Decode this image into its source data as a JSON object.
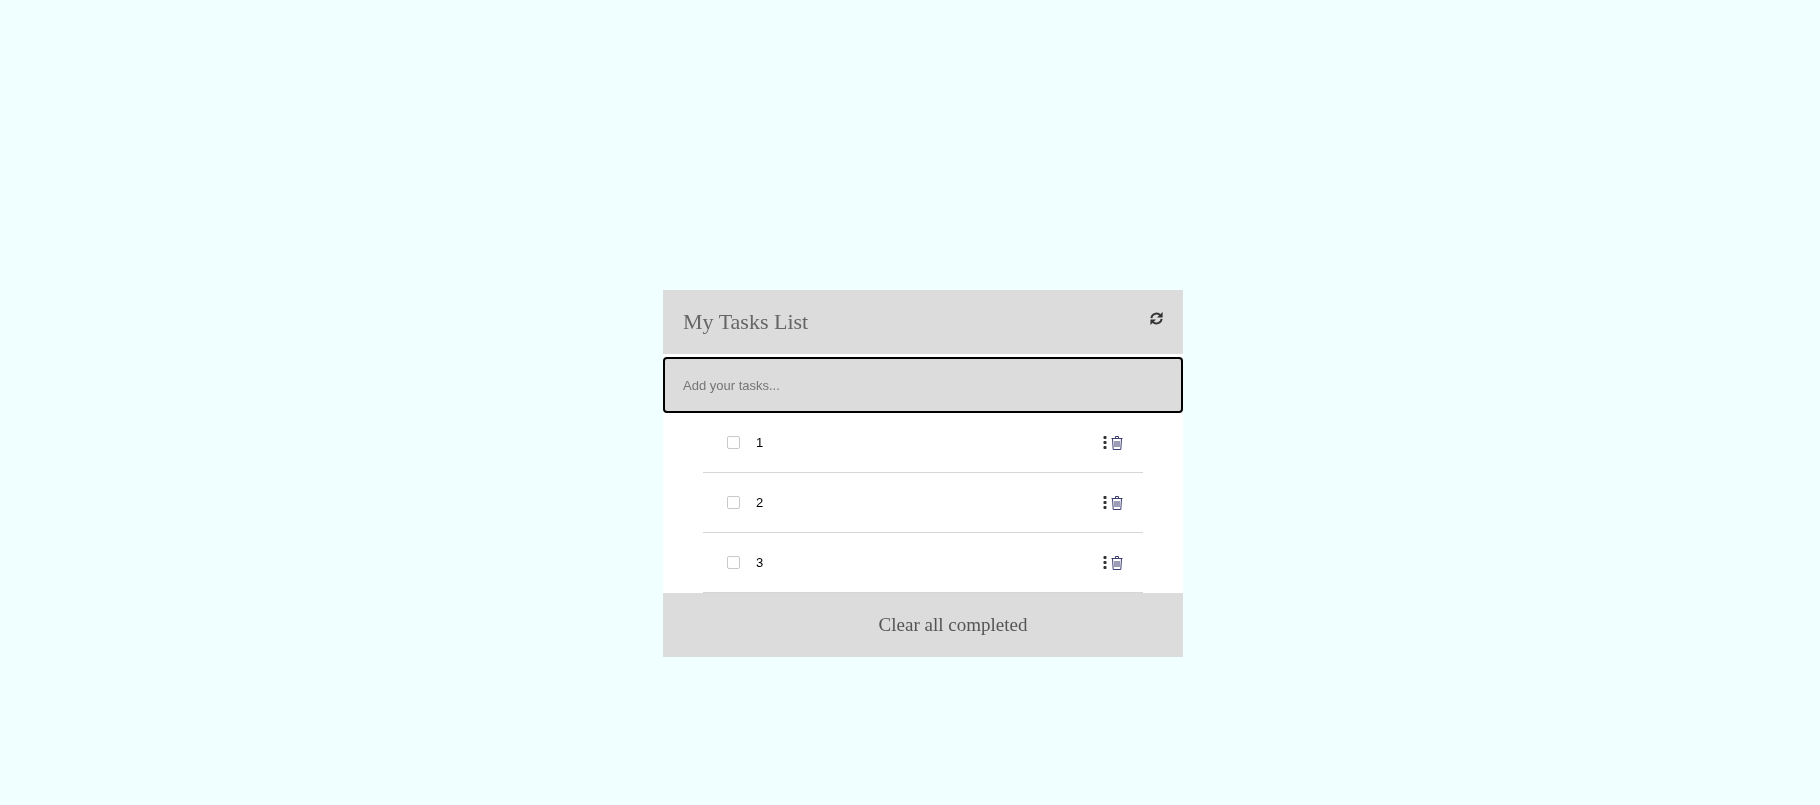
{
  "header": {
    "title": "My Tasks List"
  },
  "new_task": {
    "placeholder": "Add your tasks..."
  },
  "tasks": [
    {
      "text": "1",
      "checked": false
    },
    {
      "text": "2",
      "checked": false
    },
    {
      "text": "3",
      "checked": false
    }
  ],
  "footer": {
    "button": "Clear all completed"
  }
}
